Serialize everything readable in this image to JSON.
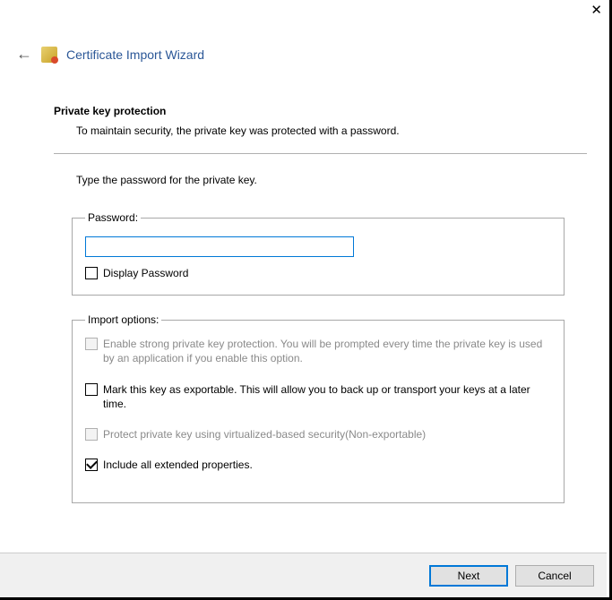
{
  "header": {
    "title": "Certificate Import Wizard"
  },
  "section": {
    "title": "Private key protection",
    "description": "To maintain security, the private key was protected with a password."
  },
  "instruction": "Type the password for the private key.",
  "password_group": {
    "legend": "Password:",
    "value": "",
    "display_password_label": "Display Password"
  },
  "import_group": {
    "legend": "Import options:",
    "opt_strong": "Enable strong private key protection. You will be prompted every time the private key is used by an application if you enable this option.",
    "opt_exportable": "Mark this key as exportable. This will allow you to back up or transport your keys at a later time.",
    "opt_vbs": "Protect private key using virtualized-based security(Non-exportable)",
    "opt_extended": "Include all extended properties."
  },
  "footer": {
    "next": "Next",
    "cancel": "Cancel"
  }
}
